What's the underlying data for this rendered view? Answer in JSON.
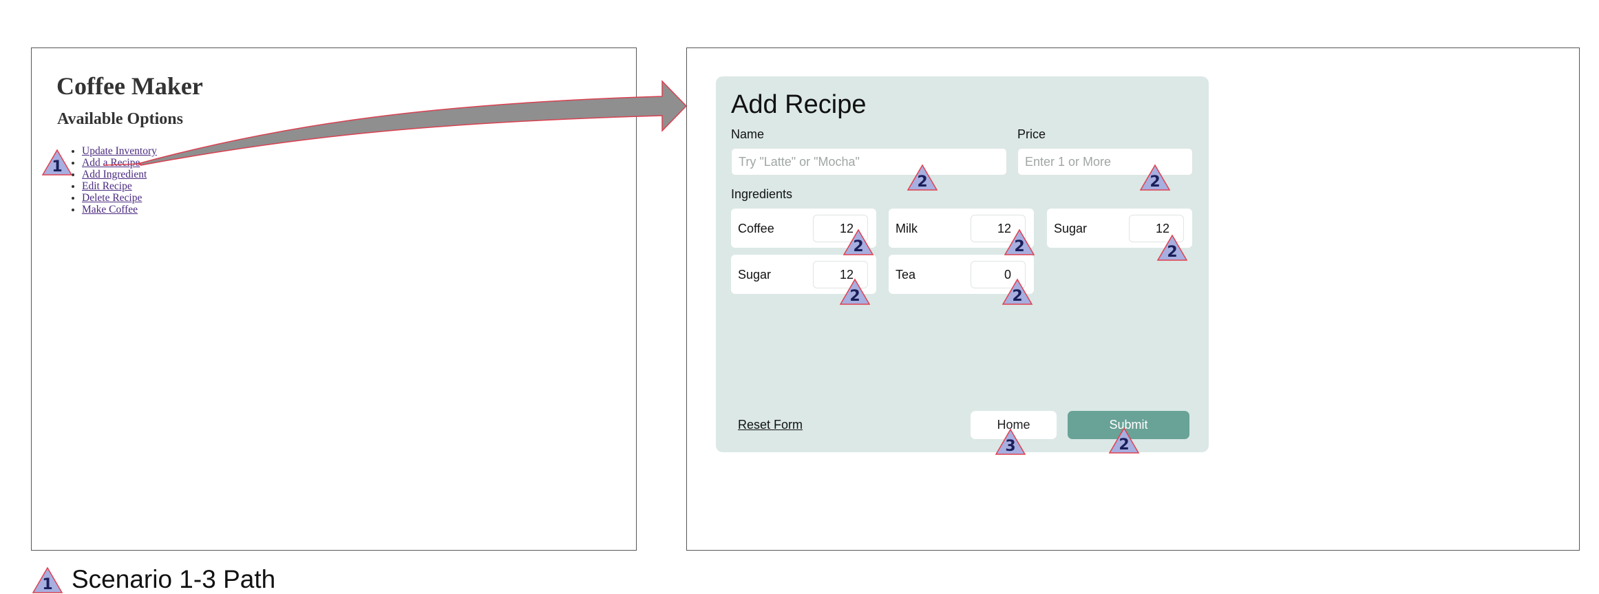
{
  "coffee_maker": {
    "title": "Coffee Maker",
    "subtitle": "Available Options",
    "options": [
      "Update Inventory",
      "Add a Recipe",
      "Add Ingredient",
      "Edit Recipe",
      "Delete Recipe",
      "Make Coffee"
    ]
  },
  "add_recipe": {
    "title": "Add Recipe",
    "name_label": "Name",
    "name_placeholder": "Try \"Latte\" or \"Mocha\"",
    "price_label": "Price",
    "price_placeholder": "Enter 1 or More",
    "ingredients_label": "Ingredients",
    "ingredients": [
      {
        "name": "Coffee",
        "value": "12"
      },
      {
        "name": "Milk",
        "value": "12"
      },
      {
        "name": "Sugar",
        "value": "12"
      },
      {
        "name": "Sugar",
        "value": "12"
      },
      {
        "name": "Tea",
        "value": "0"
      }
    ],
    "reset_label": "Reset Form",
    "home_label": "Home",
    "submit_label": "Submit"
  },
  "markers": {
    "step1": "1",
    "step2": "2",
    "step3": "3"
  },
  "legend": {
    "marker": "1",
    "text": "Scenario 1-3 Path"
  },
  "colors": {
    "panel_bg": "#dbe8e6",
    "submit": "#69a297",
    "marker_fill": "#a7aee0",
    "marker_stroke": "#e0404f",
    "link": "#4a2a80"
  }
}
